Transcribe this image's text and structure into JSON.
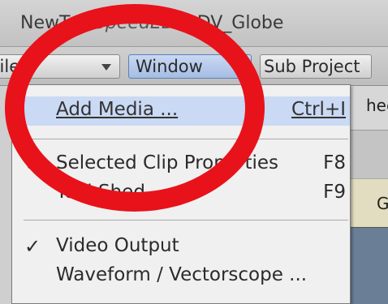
{
  "window": {
    "title_app": "NewTek",
    "title_product": "SpeedEDIT",
    "title_project": "DV_Globe"
  },
  "menubar": {
    "items": [
      {
        "label": "File"
      },
      {
        "label": "Window"
      },
      {
        "label": "Sub Project"
      }
    ]
  },
  "background_panel": {
    "fragment_top": "hee",
    "fragment_bottom": "G"
  },
  "dropdown": {
    "items": [
      {
        "label": "Add Media ...",
        "shortcut": "Ctrl+I",
        "checked": false,
        "highlighted": true
      },
      {
        "label": "Selected Clip Properties",
        "shortcut": "F8",
        "checked": true,
        "highlighted": false
      },
      {
        "label": "Tool Shed",
        "shortcut": "F9",
        "checked": false,
        "highlighted": false
      },
      {
        "label": "Video Output",
        "shortcut": "",
        "checked": true,
        "highlighted": false
      },
      {
        "label": "Waveform / Vectorscope ...",
        "shortcut": "",
        "checked": false,
        "highlighted": false
      }
    ],
    "check_glyph": "✓"
  },
  "annotation": {
    "color": "#e8121a",
    "shape": "ellipse"
  }
}
